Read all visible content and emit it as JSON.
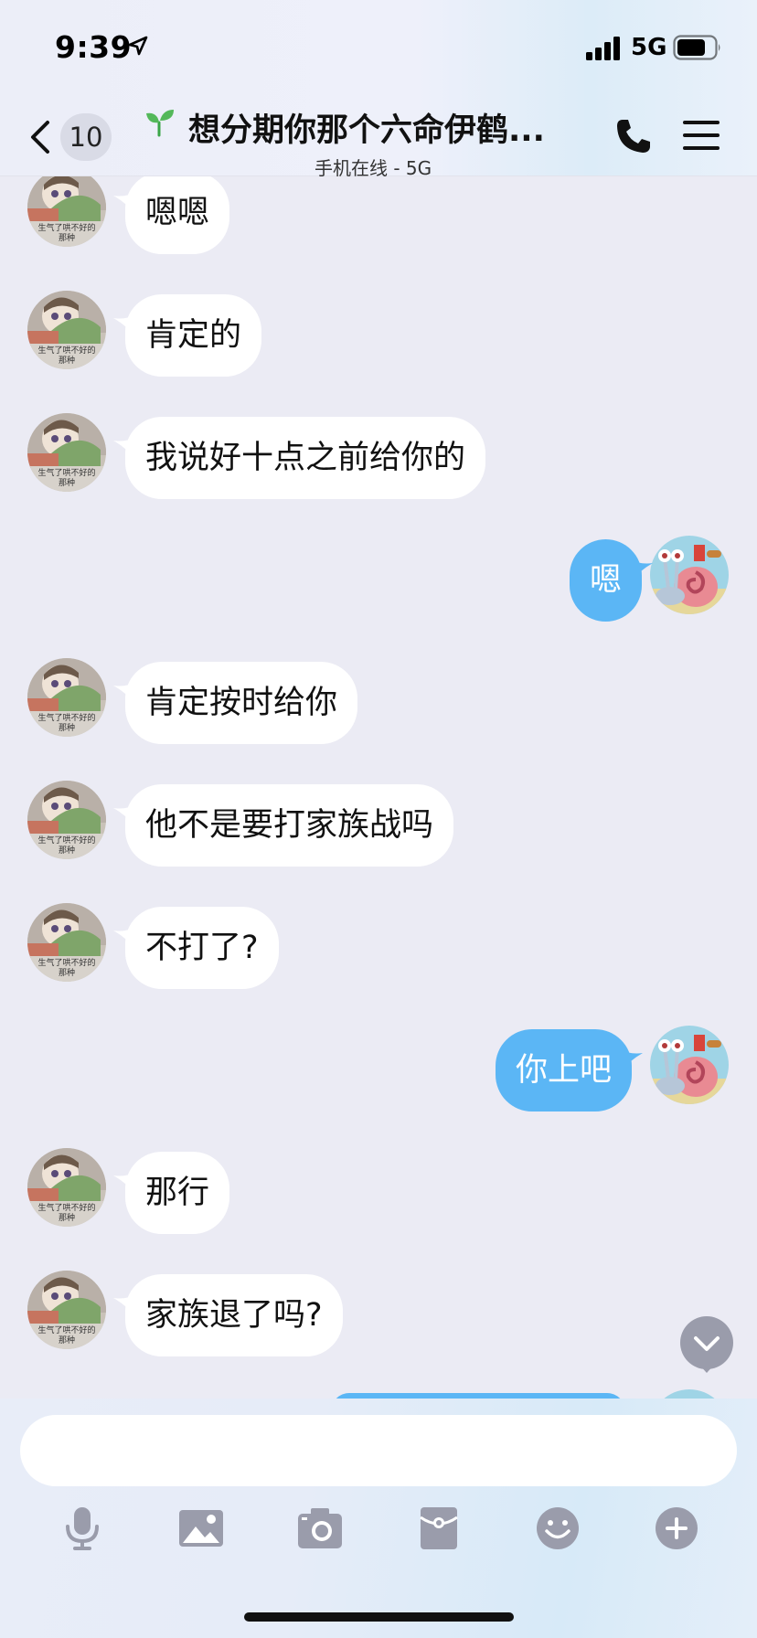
{
  "status_bar": {
    "time": "9:39",
    "network": "5G"
  },
  "header": {
    "unread_count": "10",
    "title": "想分期你那个六命伊鹤...",
    "subtitle": "手机在线 - 5G"
  },
  "messages": [
    {
      "side": "in",
      "text": "嗯嗯"
    },
    {
      "side": "in",
      "text": "肯定的"
    },
    {
      "side": "in",
      "text": "我说好十点之前给你的"
    },
    {
      "side": "out",
      "text": "嗯"
    },
    {
      "side": "in",
      "text": "肯定按时给你"
    },
    {
      "side": "in",
      "text": "他不是要打家族战吗"
    },
    {
      "side": "in",
      "text": "不打了?"
    },
    {
      "side": "out",
      "text": "你上吧"
    },
    {
      "side": "in",
      "text": "那行"
    },
    {
      "side": "in",
      "text": "家族退了吗?"
    }
  ],
  "avatar_caption": "生气了哄不好的那种",
  "input": {
    "value": ""
  },
  "colors": {
    "outgoing_bubble": "#5bb6f5",
    "incoming_bubble": "#ffffff",
    "background": "#ebebf4"
  },
  "toolbar_icons": [
    "microphone-icon",
    "image-icon",
    "camera-icon",
    "red-packet-icon",
    "emoji-icon",
    "plus-icon"
  ]
}
